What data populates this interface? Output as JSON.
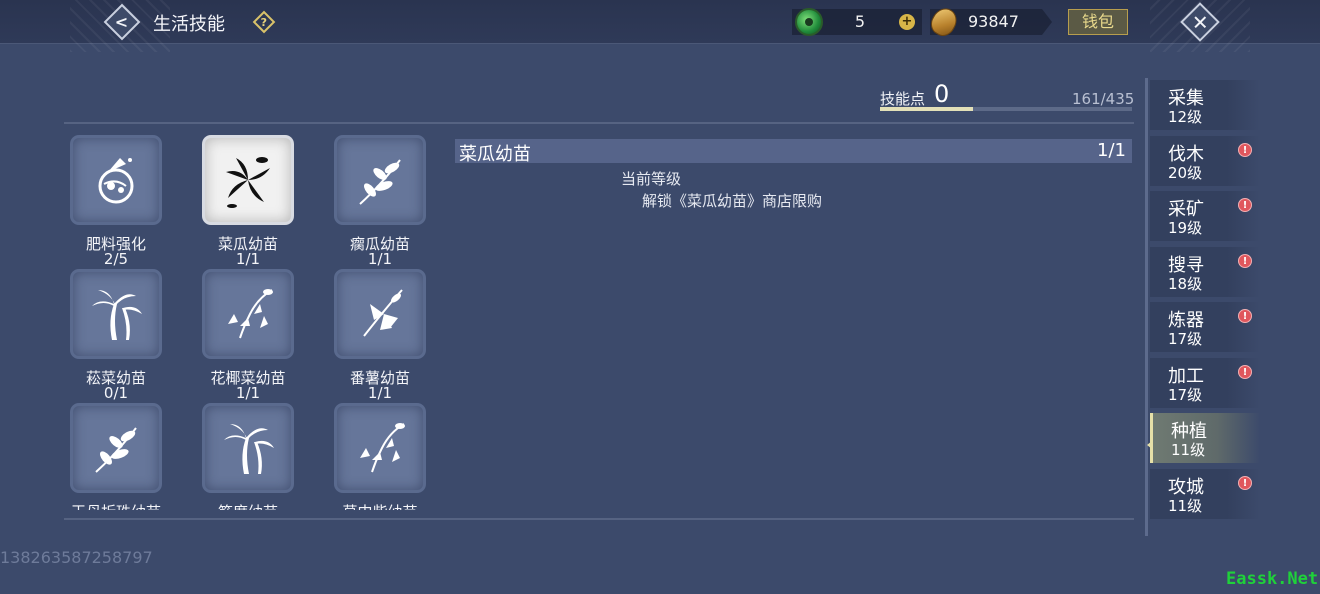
{
  "header": {
    "title": "生活技能",
    "help_glyph": "?",
    "back_glyph": "<",
    "close_glyph": "✕",
    "currency_jade": {
      "icon": "jade-coin-icon",
      "value": "5",
      "add_glyph": "+"
    },
    "currency_gold": {
      "icon": "gold-ingot-icon",
      "value": "93847"
    },
    "wallet_label": "钱包"
  },
  "skill_points": {
    "label": "技能点",
    "value": "0",
    "progress_text": "161/435",
    "progress_fraction": 0.37
  },
  "skills": [
    {
      "name": "肥料强化",
      "level": "2/5",
      "icon": "fertilizer-bag-icon"
    },
    {
      "name": "菜瓜幼苗",
      "level": "1/1",
      "icon": "black-flower-icon",
      "selected": true
    },
    {
      "name": "瘸瓜幼苗",
      "level": "1/1",
      "icon": "leafy-branch-icon"
    },
    {
      "name": "菘菜幼苗",
      "level": "0/1",
      "icon": "palm-tree-icon"
    },
    {
      "name": "花椰菜幼苗",
      "level": "1/1",
      "icon": "hanging-flowers-icon"
    },
    {
      "name": "番薯幼苗",
      "level": "1/1",
      "icon": "flower-branch-icon"
    },
    {
      "name": "王母折珠幼苗",
      "level": "",
      "icon": "leafy-branch-icon"
    },
    {
      "name": "筋度幼苗",
      "level": "",
      "icon": "palm-tree-icon"
    },
    {
      "name": "草中柴幼苗",
      "level": "",
      "icon": "hanging-flowers-icon"
    }
  ],
  "detail": {
    "name": "菜瓜幼苗",
    "level": "1/1",
    "current_level_label": "当前等级",
    "current_level_desc": "解锁《菜瓜幼苗》商店限购"
  },
  "tabs": [
    {
      "name": "采集",
      "level": "12级",
      "alert": false
    },
    {
      "name": "伐木",
      "level": "20级",
      "alert": true
    },
    {
      "name": "采矿",
      "level": "19级",
      "alert": true
    },
    {
      "name": "搜寻",
      "level": "18级",
      "alert": true
    },
    {
      "name": "炼器",
      "level": "17级",
      "alert": true
    },
    {
      "name": "加工",
      "level": "17级",
      "alert": true
    },
    {
      "name": "种植",
      "level": "11级",
      "alert": false,
      "active": true
    },
    {
      "name": "攻城",
      "level": "11级",
      "alert": true
    }
  ],
  "alert_glyph": "!",
  "player_id": "138263587258797",
  "watermark": "Eassk.Net",
  "colors": {
    "background": "#3c4a6b",
    "accent_gold": "#e3e0b8",
    "alert_red": "#e0575d",
    "watermark_green": "#1fd13a"
  }
}
